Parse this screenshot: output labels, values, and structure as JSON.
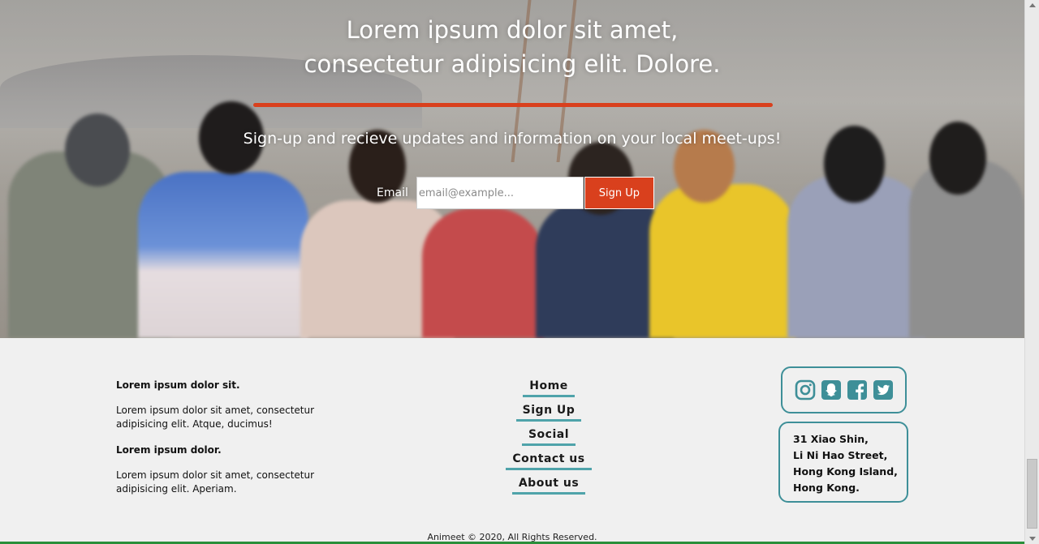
{
  "hero": {
    "title_line1": "Lorem ipsum dolor sit amet,",
    "title_line2": "consectetur adipisicing elit. Dolore.",
    "subtitle": "Sign-up and recieve updates and information on your local meet-ups!",
    "email_label": "Email",
    "email_placeholder": "email@example...",
    "signup_button": "Sign Up",
    "accent_color": "#d9401d"
  },
  "footer": {
    "col1": {
      "heading1": "Lorem ipsum dolor sit.",
      "text1": "Lorem ipsum dolor sit amet, consectetur adipisicing elit. Atque, ducimus!",
      "heading2": "Lorem ipsum dolor.",
      "text2": "Lorem ipsum dolor sit amet, consectetur adipisicing elit. Aperiam."
    },
    "nav": [
      {
        "label": "Home"
      },
      {
        "label": "Sign Up"
      },
      {
        "label": "Social"
      },
      {
        "label": "Contact us"
      },
      {
        "label": "About us"
      }
    ],
    "social_icons": [
      "instagram-icon",
      "snapchat-icon",
      "facebook-icon",
      "twitter-icon"
    ],
    "address": {
      "line1": "31 Xiao Shin,",
      "line2": "Li Ni Hao Street,",
      "line3": "Hong Kong Island,",
      "line4": "Hong Kong."
    },
    "teal_color": "#3e8f98",
    "copyright": "Animeet © 2020, All Rights Reserved."
  }
}
